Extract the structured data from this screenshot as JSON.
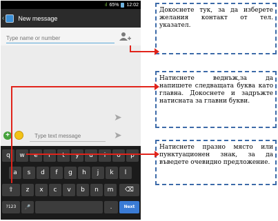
{
  "status": {
    "signal_text": "ıl",
    "battery": "65%",
    "time": "12:02"
  },
  "header": {
    "title": "New message"
  },
  "to": {
    "placeholder": "Type name or number"
  },
  "composer": {
    "placeholder": "Type text message"
  },
  "keyboard": {
    "row1": [
      "q",
      "w",
      "e",
      "r",
      "t",
      "y",
      "u",
      "i",
      "o",
      "p"
    ],
    "row2": [
      "a",
      "s",
      "d",
      "f",
      "g",
      "h",
      "j",
      "k",
      "l"
    ],
    "row3": [
      "⇧",
      "z",
      "x",
      "c",
      "v",
      "b",
      "n",
      "m",
      "⌫"
    ],
    "row4": [
      "?123",
      "🎤",
      "",
      ".",
      "Next"
    ]
  },
  "callouts": [
    {
      "text": "Докоснете тук, за да изберете желания контакт от тел. указател."
    },
    {
      "text": "Натиснете веднъж,за да напишете следващата буква като главна. Докоснете и задръжте натисната за главни букви."
    },
    {
      "text": "Натиснете празно място или пунктуационен знак, за да въведете очевидно предложение."
    }
  ],
  "colors": {
    "arrow": "#e1231a",
    "callout_border": "#3c6aa8",
    "accent": "#5aa8d8"
  }
}
